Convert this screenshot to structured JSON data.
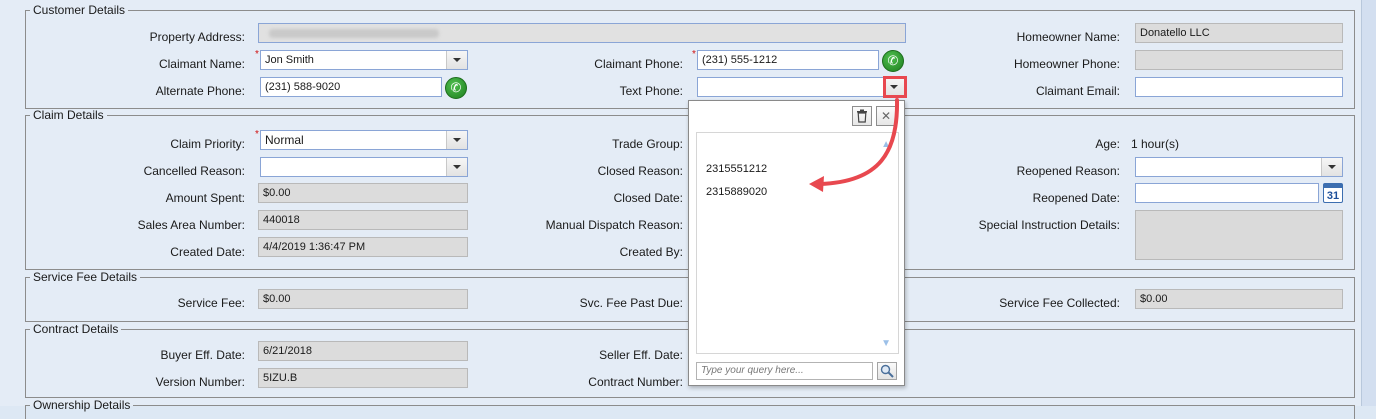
{
  "customer_details": {
    "legend": "Customer Details",
    "property_address_label": "Property Address:",
    "property_address_value": "",
    "claimant_name_label": "Claimant Name:",
    "claimant_name_value": "Jon Smith",
    "alternate_phone_label": "Alternate Phone:",
    "alternate_phone_value": "(231) 588-9020",
    "claimant_phone_label": "Claimant Phone:",
    "claimant_phone_value": "(231) 555-1212",
    "text_phone_label": "Text Phone:",
    "text_phone_value": "",
    "homeowner_name_label": "Homeowner Name:",
    "homeowner_name_value": "Donatello LLC",
    "homeowner_phone_label": "Homeowner Phone:",
    "homeowner_phone_value": "",
    "claimant_email_label": "Claimant Email:",
    "claimant_email_value": ""
  },
  "claim_details": {
    "legend": "Claim Details",
    "claim_priority_label": "Claim Priority:",
    "claim_priority_value": "Normal",
    "cancelled_reason_label": "Cancelled Reason:",
    "cancelled_reason_value": "",
    "amount_spent_label": "Amount Spent:",
    "amount_spent_value": "$0.00",
    "sales_area_label": "Sales Area Number:",
    "sales_area_value": "440018",
    "created_date_label": "Created Date:",
    "created_date_value": "4/4/2019 1:36:47 PM",
    "trade_group_label": "Trade Group:",
    "closed_reason_label": "Closed Reason:",
    "closed_date_label": "Closed Date:",
    "manual_dispatch_label": "Manual Dispatch Reason:",
    "created_by_label": "Created By:",
    "age_label": "Age:",
    "age_value": "1 hour(s)",
    "reopened_reason_label": "Reopened Reason:",
    "reopened_reason_value": "",
    "reopened_date_label": "Reopened Date:",
    "reopened_date_value": "",
    "special_instruction_label": "Special Instruction Details:",
    "special_instruction_value": ""
  },
  "service_fee_details": {
    "legend": "Service Fee  Details",
    "service_fee_label": "Service Fee:",
    "service_fee_value": "$0.00",
    "past_due_label": "Svc. Fee Past Due:",
    "collected_label": "Service Fee Collected:",
    "collected_value": "$0.00"
  },
  "contract_details": {
    "legend": "Contract Details",
    "buyer_eff_date_label": "Buyer Eff. Date:",
    "buyer_eff_date_value": "6/21/2018",
    "version_number_label": "Version Number:",
    "version_number_value": "5IZU.B",
    "seller_eff_date_label": "Seller Eff. Date:",
    "contract_number_label": "Contract Number:"
  },
  "next_section_legend": "Ownership Details",
  "popup": {
    "items": [
      "2315551212",
      "2315889020"
    ],
    "search_placeholder": "Type your query here..."
  },
  "icons": {
    "phone": "phone-icon",
    "calendar": "calendar-icon",
    "calendar_text": "31",
    "clear": "trash-icon",
    "close": "close-icon",
    "search": "magnifier-icon"
  },
  "colors": {
    "annotation": "#e8484f",
    "phone_green": "#2a8c2a",
    "required": "#d01010"
  }
}
